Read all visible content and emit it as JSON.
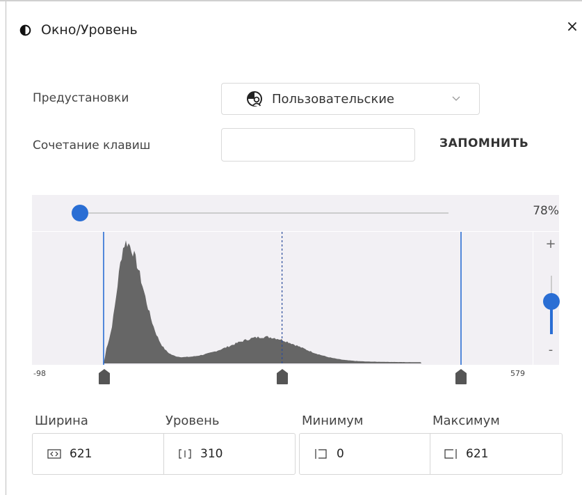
{
  "window": {
    "title": "Окно/Уровень",
    "title_icon": "half-circle-icon",
    "close_glyph": "×"
  },
  "presets": {
    "label": "Предустановки",
    "selected": "Пользовательские",
    "icon": "custom-preset-icon"
  },
  "shortcut": {
    "label": "Сочетание клавиш",
    "value": "",
    "remember_label": "ЗАПОМНИТЬ"
  },
  "histogram": {
    "opacity_percent": "78%",
    "opacity_value": 0.02,
    "zoom_plus": "+",
    "zoom_minus": "-",
    "zoom_value": 0.43,
    "axis_min": "-98",
    "axis_max": "579",
    "range_min": -98,
    "range_max": 579,
    "window_low": 0,
    "window_center": 310,
    "window_high": 621,
    "line_color": "#2a6ed4",
    "fill_color": "#666666"
  },
  "fields": {
    "width": {
      "label": "Ширина",
      "value": "621",
      "icon": "width-icon"
    },
    "level": {
      "label": "Уровень",
      "value": "310",
      "icon": "level-icon"
    },
    "minimum": {
      "label": "Минимум",
      "value": "0",
      "icon": "minimum-icon"
    },
    "maximum": {
      "label": "Максимум",
      "value": "621",
      "icon": "maximum-icon"
    }
  },
  "colors": {
    "accent": "#2a6ed4",
    "panel_bg": "#f2f0f4",
    "border": "#d6d6d6"
  }
}
